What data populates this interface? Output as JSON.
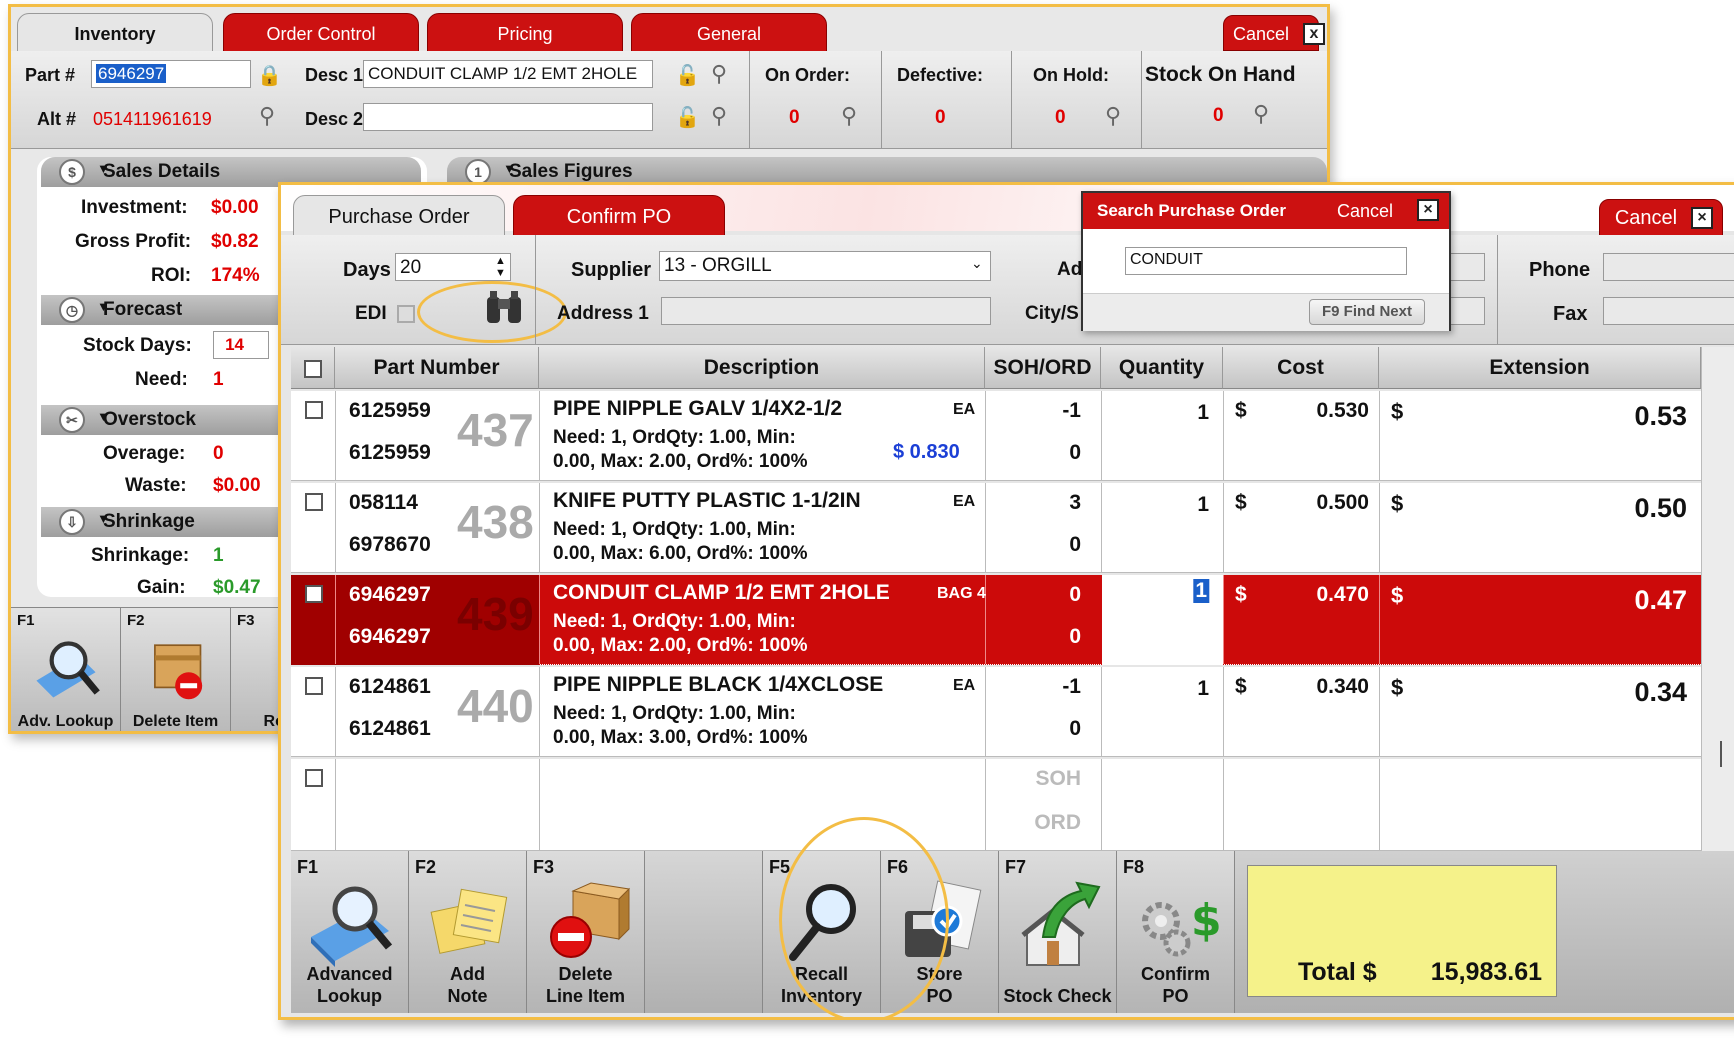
{
  "inventory": {
    "tabs": [
      "Inventory",
      "Order Control",
      "Pricing",
      "General"
    ],
    "cancel": "Cancel",
    "close": "x",
    "part_label": "Part #",
    "part_value": "6946297",
    "alt_label": "Alt #",
    "alt_value": "051411961619",
    "desc1_label": "Desc 1",
    "desc1_value": "CONDUIT CLAMP 1/2 EMT 2HOLE",
    "desc2_label": "Desc 2",
    "desc2_value": "",
    "stats": [
      {
        "label": "On Order:",
        "value": "0"
      },
      {
        "label": "Defective:",
        "value": "0"
      },
      {
        "label": "On Hold:",
        "value": "0"
      },
      {
        "label": "Stock On Hand",
        "value": "0"
      }
    ],
    "sales_details": {
      "title": "Sales Details",
      "investment_label": "Investment:",
      "investment": "$0.00",
      "gp_label": "Gross Profit:",
      "gp": "$0.82",
      "roi_label": "ROI:",
      "roi": "174%"
    },
    "sales_figures": {
      "title": "Sales Figures",
      "num": "1"
    },
    "forecast": {
      "title": "Forecast",
      "stock_days_label": "Stock Days:",
      "stock_days": "14",
      "need_label": "Need:",
      "need": "1"
    },
    "overstock": {
      "title": "Overstock",
      "overage_label": "Overage:",
      "overage": "0",
      "waste_label": "Waste:",
      "waste": "$0.00"
    },
    "shrinkage": {
      "title": "Shrinkage",
      "shrink_label": "Shrinkage:",
      "shrink": "1",
      "gain_label": "Gain:",
      "gain": "$0.47"
    },
    "fkeys": [
      {
        "key": "F1",
        "label": "Adv. Lookup"
      },
      {
        "key": "F2",
        "label": "Delete Item"
      },
      {
        "key": "F3",
        "label": "Re"
      }
    ]
  },
  "po": {
    "tabs": [
      "Purchase Order",
      "Confirm PO"
    ],
    "cancel": "Cancel",
    "days_label": "Days",
    "days": "20",
    "edi_label": "EDI",
    "supplier_label": "Supplier",
    "supplier": "13 - ORGILL",
    "address_label": "Address 1",
    "ad_label": "Ad",
    "city_label": "City/S",
    "phone_label": "Phone",
    "fax_label": "Fax",
    "columns": [
      "Part Number",
      "Description",
      "SOH/ORD",
      "Quantity",
      "Cost",
      "Extension"
    ],
    "rows": [
      {
        "part1": "6125959",
        "part2": "6125959",
        "num": "437",
        "desc": "PIPE NIPPLE GALV 1/4X2-1/2",
        "unit": "EA",
        "detail1": "Need: 1, OrdQty: 1.00, Min:",
        "detail2": "0.00, Max: 2.00, Ord%: 100%",
        "price": "$ 0.830",
        "soh": "-1",
        "ord": "0",
        "qty": "1",
        "cur": "$",
        "cost": "0.530",
        "ext_cur": "$",
        "ext": "0.53"
      },
      {
        "part1": "058114",
        "part2": "6978670",
        "num": "438",
        "desc": "KNIFE PUTTY PLASTIC 1-1/2IN",
        "unit": "EA",
        "detail1": "Need: 1, OrdQty: 1.00, Min:",
        "detail2": "0.00, Max: 6.00, Ord%: 100%",
        "price": "",
        "soh": "3",
        "ord": "0",
        "qty": "1",
        "cur": "$",
        "cost": "0.500",
        "ext_cur": "$",
        "ext": "0.50"
      },
      {
        "part1": "6946297",
        "part2": "6946297",
        "num": "439",
        "desc": "CONDUIT CLAMP 1/2 EMT 2HOLE",
        "unit": "BAG 4",
        "detail1": "Need: 1, OrdQty: 1.00, Min:",
        "detail2": "0.00, Max: 2.00, Ord%: 100%",
        "price": "",
        "soh": "0",
        "ord": "0",
        "qty": "1",
        "cur": "$",
        "cost": "0.470",
        "ext_cur": "$",
        "ext": "0.47"
      },
      {
        "part1": "6124861",
        "part2": "6124861",
        "num": "440",
        "desc": "PIPE NIPPLE BLACK 1/4XCLOSE",
        "unit": "EA",
        "detail1": "Need: 1, OrdQty: 1.00, Min:",
        "detail2": "0.00, Max: 3.00, Ord%: 100%",
        "price": "",
        "soh": "-1",
        "ord": "0",
        "qty": "1",
        "cur": "$",
        "cost": "0.340",
        "ext_cur": "$",
        "ext": "0.34"
      }
    ],
    "empty_soh": "SOH",
    "empty_ord": "ORD",
    "fkeys": [
      {
        "key": "F1",
        "label1": "Advanced",
        "label2": "Lookup"
      },
      {
        "key": "F2",
        "label1": "Add",
        "label2": "Note"
      },
      {
        "key": "F3",
        "label1": "Delete",
        "label2": "Line Item"
      },
      {
        "key": "F5",
        "label1": "Recall",
        "label2": "Inventory"
      },
      {
        "key": "F6",
        "label1": "Store",
        "label2": "PO"
      },
      {
        "key": "F7",
        "label1": "",
        "label2": "Stock Check"
      },
      {
        "key": "F8",
        "label1": "Confirm",
        "label2": "PO"
      }
    ],
    "total_label": "Total $",
    "total": "15,983.61"
  },
  "search": {
    "title": "Search Purchase Order",
    "cancel": "Cancel",
    "query": "CONDUIT",
    "find_next": "F9 Find Next"
  },
  "colors": {
    "accent": "#cc1111",
    "highlight": "#f3bd45",
    "total_bg": "#f5f28a"
  }
}
